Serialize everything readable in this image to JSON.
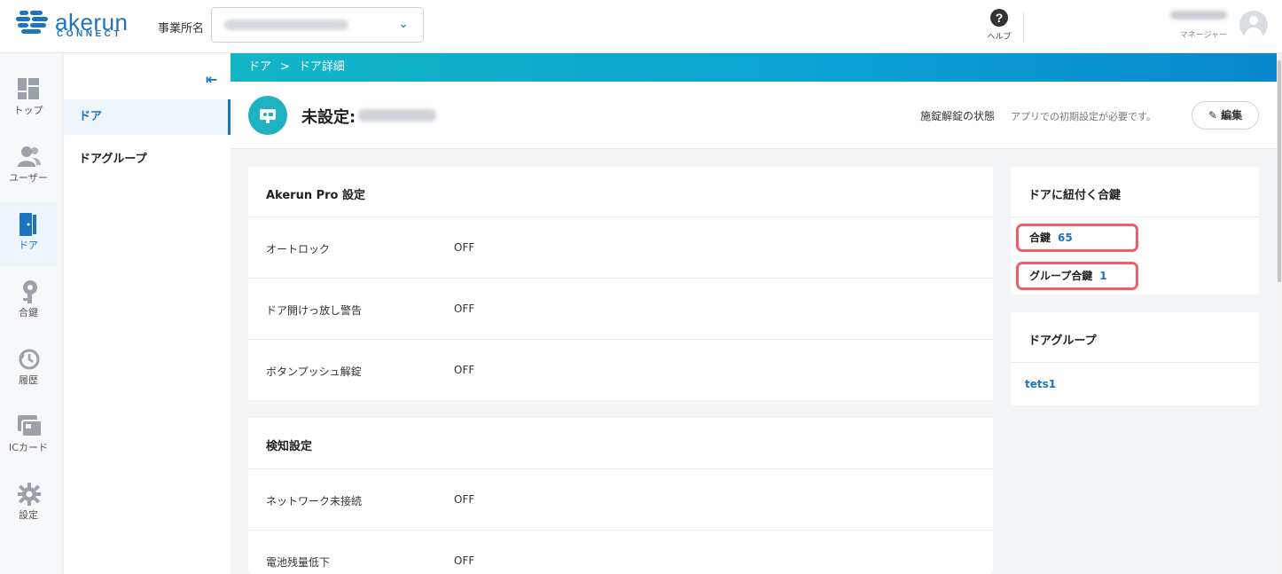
{
  "header": {
    "logo_word": "akerun",
    "logo_sub": "CONNECT",
    "office_label": "事業所名",
    "help_label": "ヘルプ",
    "user_role": "マネージャー"
  },
  "leftnav": [
    {
      "label": "トップ",
      "icon": "grid-icon"
    },
    {
      "label": "ユーザー",
      "icon": "users-icon"
    },
    {
      "label": "ドア",
      "icon": "door-icon"
    },
    {
      "label": "合鍵",
      "icon": "key-icon"
    },
    {
      "label": "履歴",
      "icon": "history-icon"
    },
    {
      "label": "ICカード",
      "icon": "ic-card-icon"
    },
    {
      "label": "設定",
      "icon": "gear-icon"
    }
  ],
  "subnav": {
    "items": [
      {
        "label": "ドア"
      },
      {
        "label": "ドアグループ"
      }
    ]
  },
  "breadcrumb": {
    "root": "ドア",
    "separator": ">",
    "current": "ドア詳細"
  },
  "door": {
    "title_prefix": "未設定:",
    "lock_status_label": "施錠解錠の状態",
    "lock_status_value": "アプリでの初期設定が必要です。",
    "edit_label": "編集"
  },
  "pro_settings": {
    "title": "Akerun Pro 設定",
    "rows": [
      {
        "label": "オートロック",
        "value": "OFF"
      },
      {
        "label": "ドア開けっ放し警告",
        "value": "OFF"
      },
      {
        "label": "ボタンプッシュ解錠",
        "value": "OFF"
      }
    ]
  },
  "detect_settings": {
    "title": "検知設定",
    "rows": [
      {
        "label": "ネットワーク未接続",
        "value": "OFF"
      },
      {
        "label": "電池残量低下",
        "value": "OFF"
      }
    ]
  },
  "keys": {
    "title": "ドアに紐付く合鍵",
    "key_label": "合鍵",
    "key_count": "65",
    "group_key_label": "グループ合鍵",
    "group_key_count": "1"
  },
  "door_group": {
    "title": "ドアグループ",
    "item": "tets1"
  },
  "colors": {
    "accent": "#1e73be",
    "teal": "#1fb3c1",
    "highlight": "#ef5e68"
  }
}
